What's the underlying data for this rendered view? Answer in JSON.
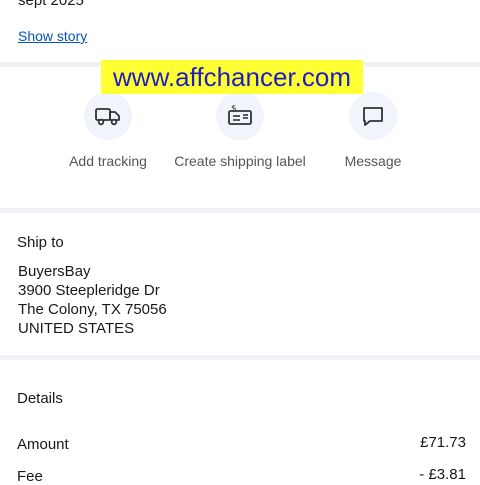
{
  "order": {
    "date_fragment": "sept 2025",
    "show_story_label": "Show story"
  },
  "watermark": {
    "text": "www.affchancer.com"
  },
  "actions": [
    {
      "label": "Add tracking",
      "icon": "truck-icon"
    },
    {
      "label": "Create shipping label",
      "icon": "shipping-label-icon"
    },
    {
      "label": "Message",
      "icon": "message-icon"
    }
  ],
  "ship_to": {
    "title": "Ship to",
    "name": "BuyersBay",
    "street": "3900 Steepleridge Dr",
    "city_line": "The Colony, TX 75056",
    "country": "UNITED STATES"
  },
  "details": {
    "title": "Details",
    "rows": [
      {
        "label": "Amount",
        "value": "£71.73"
      },
      {
        "label": "Fee",
        "value": "- £3.81"
      }
    ]
  },
  "colors": {
    "link": "#0654ba",
    "divider": "#f0f2f8",
    "icon_bg": "#f1f4fb",
    "watermark_bg": "#ffff33"
  }
}
